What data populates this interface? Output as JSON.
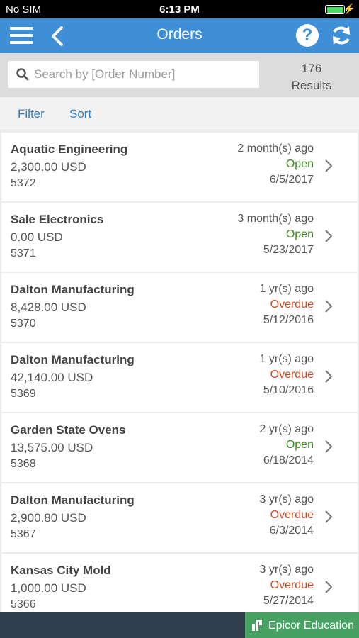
{
  "status_bar": {
    "carrier": "No SIM",
    "time": "6:13 PM",
    "battery_level": 1.0
  },
  "nav": {
    "title": "Orders"
  },
  "search": {
    "placeholder": "Search by [Order Number]",
    "value": ""
  },
  "results": {
    "count": "176",
    "label": "Results"
  },
  "toolbar": {
    "filter_label": "Filter",
    "sort_label": "Sort"
  },
  "colors": {
    "accent": "#3f8fd7",
    "open": "#3c8a1f",
    "overdue": "#d24a21",
    "brand": "#46a163"
  },
  "orders": [
    {
      "customer": "Aquatic Engineering",
      "amount": "2,300.00 USD",
      "order_number": "5372",
      "age": "2 month(s) ago",
      "status": "Open",
      "date": "6/5/2017"
    },
    {
      "customer": "Sale Electronics",
      "amount": "0.00 USD",
      "order_number": "5371",
      "age": "3 month(s) ago",
      "status": "Open",
      "date": "5/23/2017"
    },
    {
      "customer": "Dalton Manufacturing",
      "amount": "8,428.00 USD",
      "order_number": "5370",
      "age": "1 yr(s) ago",
      "status": "Overdue",
      "date": "5/12/2016"
    },
    {
      "customer": "Dalton Manufacturing",
      "amount": "42,140.00 USD",
      "order_number": "5369",
      "age": "1 yr(s) ago",
      "status": "Overdue",
      "date": "5/10/2016"
    },
    {
      "customer": "Garden State Ovens",
      "amount": "13,575.00 USD",
      "order_number": "5368",
      "age": "2 yr(s) ago",
      "status": "Open",
      "date": "6/18/2014"
    },
    {
      "customer": "Dalton Manufacturing",
      "amount": "2,900.80 USD",
      "order_number": "5367",
      "age": "3 yr(s) ago",
      "status": "Overdue",
      "date": "6/3/2014"
    },
    {
      "customer": "Kansas City Mold",
      "amount": "1,000.00 USD",
      "order_number": "5366",
      "age": "3 yr(s) ago",
      "status": "Overdue",
      "date": "5/27/2014"
    }
  ],
  "footer": {
    "brand_label": "Epicor Education"
  }
}
